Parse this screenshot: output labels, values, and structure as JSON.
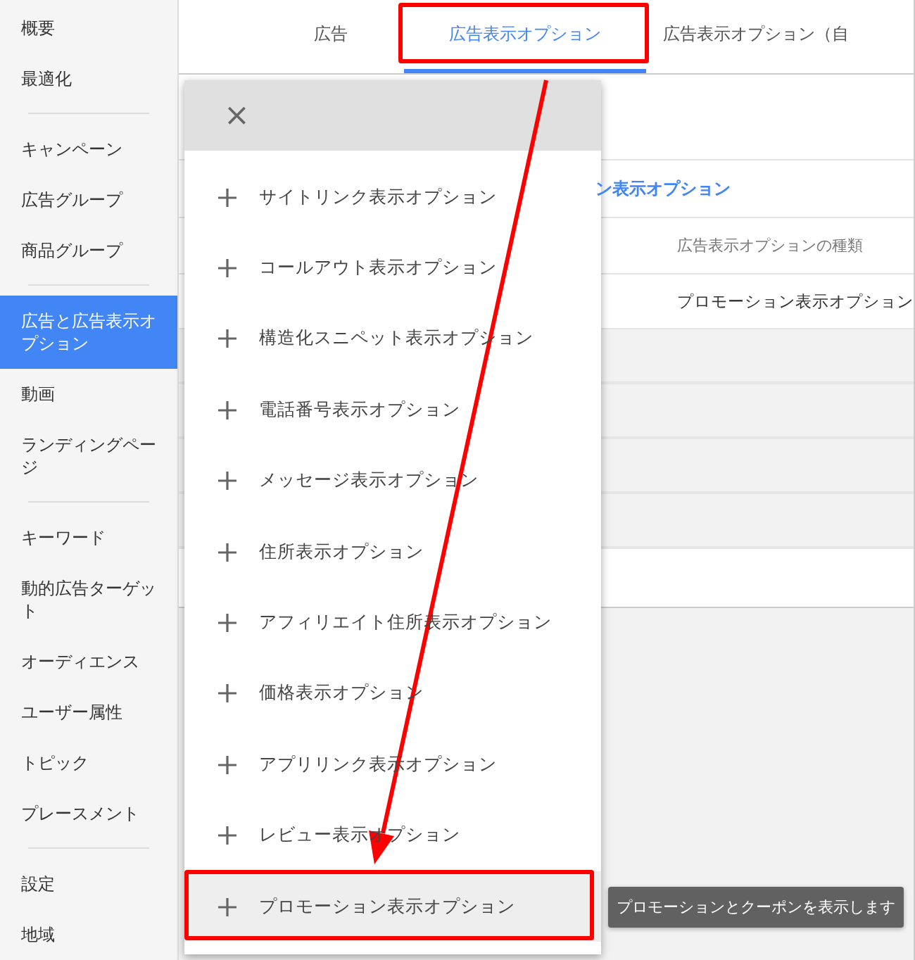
{
  "sidebar": {
    "groups": [
      {
        "items": [
          {
            "label": "概要",
            "selected": false
          },
          {
            "label": "最適化",
            "selected": false
          }
        ]
      },
      {
        "items": [
          {
            "label": "キャンペーン",
            "selected": false
          },
          {
            "label": "広告グループ",
            "selected": false
          },
          {
            "label": "商品グループ",
            "selected": false
          }
        ]
      },
      {
        "items": [
          {
            "label": "広告と広告表示オプション",
            "selected": true
          },
          {
            "label": "動画",
            "selected": false
          },
          {
            "label": "ランディングページ",
            "selected": false
          }
        ]
      },
      {
        "items": [
          {
            "label": "キーワード",
            "selected": false
          },
          {
            "label": "動的広告ターゲット",
            "selected": false
          },
          {
            "label": "オーディエンス",
            "selected": false
          },
          {
            "label": "ユーザー属性",
            "selected": false
          },
          {
            "label": "トピック",
            "selected": false
          },
          {
            "label": "プレースメント",
            "selected": false
          }
        ]
      },
      {
        "items": [
          {
            "label": "設定",
            "selected": false
          },
          {
            "label": "地域",
            "selected": false
          }
        ]
      }
    ]
  },
  "tabs": [
    {
      "label": "広告",
      "selected": false,
      "highlighted": false
    },
    {
      "label": "広告表示オプション",
      "selected": true,
      "highlighted": true
    },
    {
      "label": "広告表示オプション（自",
      "selected": false,
      "highlighted": false
    }
  ],
  "table": {
    "link": "ン表示オプション",
    "column_header": "広告表示オプションの種類",
    "cell": "プロモーション表示オプション"
  },
  "menu": {
    "close": "×",
    "items": [
      {
        "label": "サイトリンク表示オプション",
        "selected": false,
        "highlighted": false
      },
      {
        "label": "コールアウト表示オプション",
        "selected": false,
        "highlighted": false
      },
      {
        "label": "構造化スニペット表示オプション",
        "selected": false,
        "highlighted": false
      },
      {
        "label": "電話番号表示オプション",
        "selected": false,
        "highlighted": false
      },
      {
        "label": "メッセージ表示オプション",
        "selected": false,
        "highlighted": false
      },
      {
        "label": "住所表示オプション",
        "selected": false,
        "highlighted": false
      },
      {
        "label": "アフィリエイト住所表示オプション",
        "selected": false,
        "highlighted": false
      },
      {
        "label": "価格表示オプション",
        "selected": false,
        "highlighted": false
      },
      {
        "label": "アプリリンク表示オプション",
        "selected": false,
        "highlighted": false
      },
      {
        "label": "レビュー表示オプション",
        "selected": false,
        "highlighted": false
      },
      {
        "label": "プロモーション表示オプション",
        "selected": true,
        "highlighted": true
      }
    ]
  },
  "tooltip": "プロモーションとクーポンを表示します"
}
